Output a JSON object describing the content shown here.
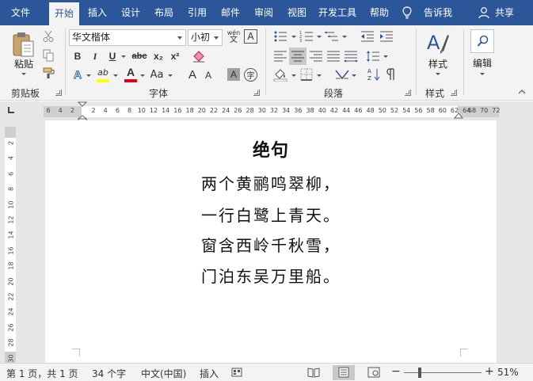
{
  "menu": {
    "tabs": [
      {
        "label": "文件"
      },
      {
        "label": "开始"
      },
      {
        "label": "插入"
      },
      {
        "label": "设计"
      },
      {
        "label": "布局"
      },
      {
        "label": "引用"
      },
      {
        "label": "邮件"
      },
      {
        "label": "审阅"
      },
      {
        "label": "视图"
      },
      {
        "label": "开发工具"
      },
      {
        "label": "帮助"
      }
    ],
    "tell_me": "告诉我",
    "share": "共享",
    "active_tab": "开始"
  },
  "ribbon": {
    "clipboard": {
      "paste_label": "粘贴",
      "group_label": "剪贴板"
    },
    "font": {
      "font_name": "华文楷体",
      "font_size": "小初",
      "group_label": "字体",
      "bold": "B",
      "italic": "I",
      "underline": "U",
      "strike": "abc",
      "subscript": "x₂",
      "superscript": "x²",
      "grow": "A",
      "shrink": "A",
      "change_case": "Aa",
      "font_color_letter": "A",
      "highlight_letter": "ab",
      "char_shading": "A",
      "enclose": "字",
      "phonetic": "wén",
      "border_letter": "A"
    },
    "paragraph": {
      "group_label": "段落"
    },
    "styles": {
      "label": "样式",
      "group_label": "样式"
    },
    "editing": {
      "label": "编辑"
    }
  },
  "ruler": {
    "left_ticks": [
      "6",
      "4",
      "2"
    ],
    "ticks": [
      "2",
      "4",
      "6",
      "8",
      "10",
      "12",
      "14",
      "16",
      "18",
      "20",
      "22",
      "24",
      "26",
      "28",
      "30",
      "32",
      "34",
      "36",
      "38",
      "40",
      "42",
      "44",
      "46",
      "48",
      "50",
      "52",
      "54",
      "56",
      "58",
      "60",
      "62",
      "64"
    ],
    "right_ticks": [
      "68",
      "70",
      "72"
    ],
    "vertical_ticks": [
      "2",
      "4",
      "6",
      "8",
      "10",
      "12",
      "14",
      "16",
      "18",
      "20",
      "22",
      "24",
      "26",
      "28",
      "30"
    ]
  },
  "document": {
    "title": "绝句",
    "lines": [
      "两个黄鹂鸣翠柳，",
      "一行白鹭上青天。",
      "窗含西岭千秋雪，",
      "门泊东吴万里船。"
    ]
  },
  "status": {
    "page": "第 1 页，共 1 页",
    "words": "34 个字",
    "language": "中文(中国)",
    "mode": "插入",
    "zoom": "51%",
    "zoom_level": 51
  },
  "colors": {
    "menu_bg": "#2b579a",
    "ribbon_bg": "#f3f3f3",
    "font_color": "#e0001b",
    "highlight": "#ffff00",
    "accent_blue": "#2b579a"
  }
}
